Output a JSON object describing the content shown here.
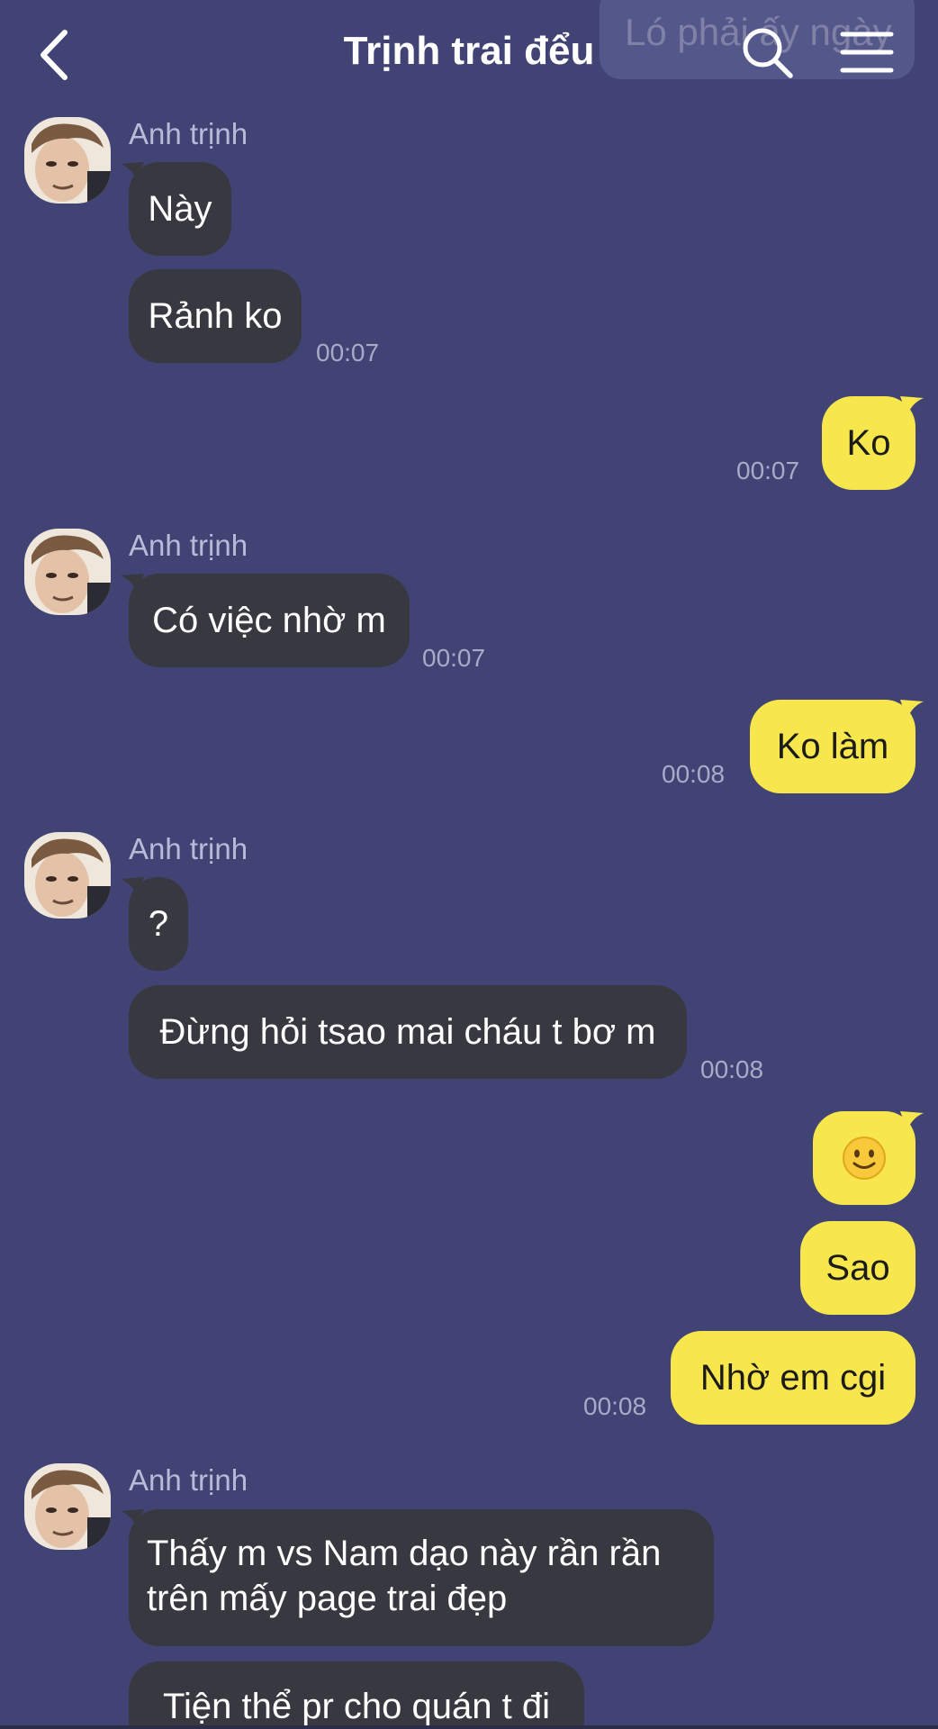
{
  "header": {
    "title": "Trịnh trai đểu",
    "back_icon": "chevron-left-icon",
    "search_icon": "search-icon",
    "menu_icon": "menu-icon",
    "pinned_notice": "Ló phải ấy ngày"
  },
  "colors": {
    "background": "#404373",
    "incoming_bubble": "#373840",
    "outgoing_bubble": "#f7e64c",
    "timestamp": "#a8abc8",
    "sender_name": "#b8bbd8"
  },
  "messages": [
    {
      "id": "m1",
      "direction": "in",
      "sender": "Anh trịnh",
      "text": "Này"
    },
    {
      "id": "m2",
      "direction": "in",
      "text": "Rảnh ko",
      "time": "00:07"
    },
    {
      "id": "m3",
      "direction": "out",
      "text": "Ko",
      "time": "00:07"
    },
    {
      "id": "m4",
      "direction": "in",
      "sender": "Anh trịnh",
      "text": "Có việc nhờ m",
      "time": "00:07"
    },
    {
      "id": "m5",
      "direction": "out",
      "text": "Ko làm",
      "time": "00:08"
    },
    {
      "id": "m6",
      "direction": "in",
      "sender": "Anh trịnh",
      "text": "?"
    },
    {
      "id": "m7",
      "direction": "in",
      "text": "Đừng hỏi tsao mai cháu t bơ m",
      "time": "00:08"
    },
    {
      "id": "m8",
      "direction": "out",
      "text": "🙂",
      "emoji_icon": "slightly-smiling-face-icon"
    },
    {
      "id": "m9",
      "direction": "out",
      "text": "Sao"
    },
    {
      "id": "m10",
      "direction": "out",
      "text": "Nhờ em cgi",
      "time": "00:08"
    },
    {
      "id": "m11",
      "direction": "in",
      "sender": "Anh trịnh",
      "text_line1": "Thấy m vs Nam dạo này rần rần",
      "text_line2": "trên mấy page trai đẹp"
    },
    {
      "id": "m12",
      "direction": "in",
      "text": "Tiện thể pr cho quán t đi"
    }
  ]
}
